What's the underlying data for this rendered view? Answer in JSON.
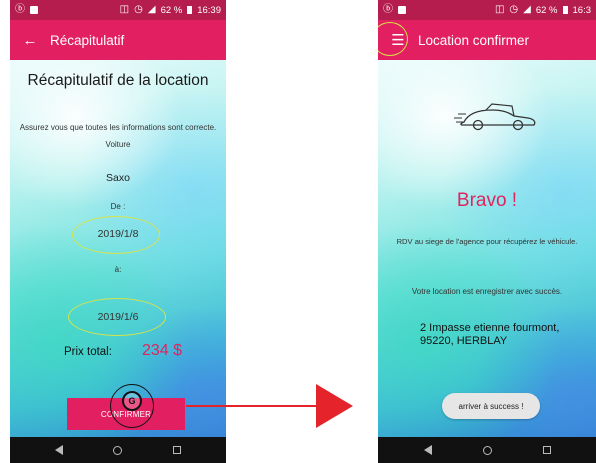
{
  "status_bar": {
    "battery": "62 %",
    "time_left": "16:39",
    "time_right": "16:3"
  },
  "screen1": {
    "appbar_title": "Récapitulatif",
    "heading": "Récapitulatif de la location",
    "subtitle": "Assurez vous que toutes les informations sont correcte.",
    "vehicle_label": "Voiture",
    "vehicle_value": "Saxo",
    "from_label": "De :",
    "from_date": "2019/1/8",
    "to_label": "à:",
    "to_date": "2019/1/6",
    "price_label": "Prix total:",
    "price_value": "234 $",
    "confirm_label": "CONFIRMER",
    "touch_glyph": "G"
  },
  "screen2": {
    "appbar_title": "Location confirmer",
    "bravo": "Bravo !",
    "rdv_text": "RDV au siege de l'agence pour récupérez le véhicule.",
    "success_text": "Votre location est enregistrer avec succès.",
    "address_line1": "2 Impasse etienne fourmont,",
    "address_line2": "95220,  HERBLAY",
    "toast_text": "arriver à success !"
  },
  "colors": {
    "accent": "#e21f61",
    "status_bar": "#b51d4f",
    "price": "#e0245e",
    "highlight_ring": "#d6e34a",
    "arrow": "#e4242a"
  }
}
